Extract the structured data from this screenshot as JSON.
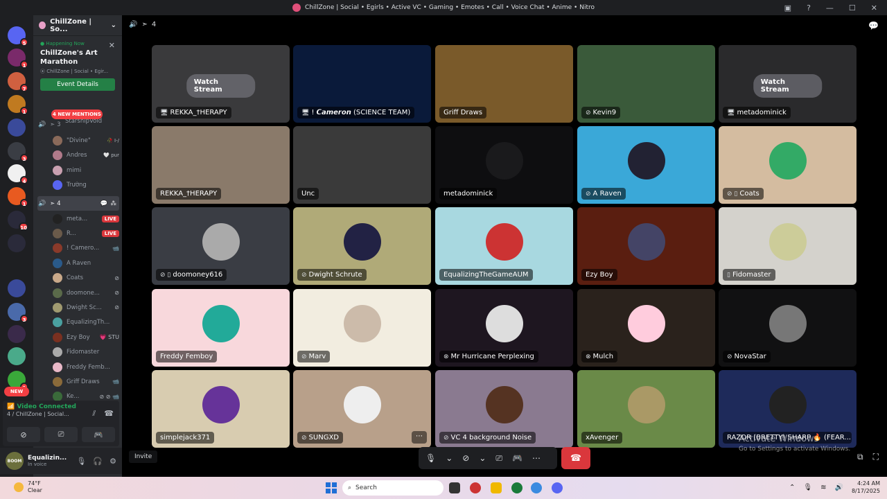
{
  "titlebar": {
    "title": "ChillZone | Social • Egirls • Active VC • Gaming • Emotes • Call • Voice Chat • Anime • Nitro"
  },
  "server_rail": {
    "badges": [
      "5",
      "1",
      "7",
      "1",
      "3",
      "4",
      "1",
      "10",
      "3",
      "1"
    ],
    "new_label": "NEW"
  },
  "sidebar": {
    "server_name": "ChillZone | So...",
    "event": {
      "status": "Happening Now",
      "title": "ChillZone's Art Marathon",
      "location": "ChillZone | Social • Egir...",
      "button": "Event Details"
    },
    "mentions": "4 NEW MENTIONS",
    "partial_user": "StarshipVoid",
    "channel3": {
      "label": "3",
      "users": [
        {
          "name": "\"Divine\"",
          "tag": "🥀 I-/",
          "color": "#8a6a5a"
        },
        {
          "name": "Andres",
          "tag": "🤍 pur",
          "color": "#b07a8a"
        },
        {
          "name": "mimi",
          "tag": "",
          "color": "#c9a0b0"
        },
        {
          "name": "Trường",
          "tag": "",
          "color": "#5865f2"
        }
      ]
    },
    "channel4": {
      "label": "4",
      "users": [
        {
          "name": "meta...",
          "live": "LIVE",
          "icon": "",
          "color": "#222"
        },
        {
          "name": "R...",
          "live": "LIVE",
          "icon": "",
          "color": "#6a5a4a"
        },
        {
          "name": "! Camero...",
          "live": "",
          "icon": "📹",
          "color": "#8a3a2a"
        },
        {
          "name": "A Raven",
          "live": "",
          "icon": "",
          "color": "#2a5a8a"
        },
        {
          "name": "Coats",
          "live": "",
          "icon": "⊘",
          "color": "#c9a98a"
        },
        {
          "name": "doomone...",
          "live": "",
          "icon": "⊘",
          "color": "#5a6a4a"
        },
        {
          "name": "Dwight Sc...",
          "live": "",
          "icon": "⊘",
          "color": "#a09a70"
        },
        {
          "name": "EqualizingTh...",
          "live": "",
          "icon": "",
          "color": "#4aa0a0"
        },
        {
          "name": "Ezy Boy",
          "live": "",
          "icon": "💗 STU",
          "color": "#7a3020"
        },
        {
          "name": "Fidomaster",
          "live": "",
          "icon": "",
          "color": "#aaa"
        },
        {
          "name": "Freddy Femb...",
          "live": "",
          "icon": "",
          "color": "#e8b8c8"
        },
        {
          "name": "Griff Draws",
          "live": "",
          "icon": "📹",
          "color": "#8a6a3a"
        },
        {
          "name": "Ke...",
          "live": "",
          "icon": "⊘ ⊘ 📹",
          "color": "#3a6a3a"
        }
      ]
    }
  },
  "voice_panel": {
    "status": "Video Connected",
    "channel": "4 / ChillZone | Social..."
  },
  "user_panel": {
    "name": "Equalizin...",
    "status": "In voice",
    "avatar_text": "BOOM"
  },
  "main": {
    "channel_label": "4",
    "tiles": [
      {
        "label": "REKKA_†HERAPY",
        "prefix": "🖥",
        "watch": "Watch Stream",
        "bg": "#3a3a3c"
      },
      {
        "label": "! 𝘾𝙖𝙢𝙚𝙧𝙤𝙣 (SCIENCE TEAM)",
        "prefix": "🖥",
        "watch": "",
        "bg": "#0a1a3a"
      },
      {
        "label": "Griff Draws",
        "prefix": "",
        "watch": "",
        "bg": "#7a5a2a"
      },
      {
        "label": "Kevin9",
        "prefix": "⊘",
        "watch": "",
        "bg": "#3a5a3a"
      },
      {
        "label": "metadominick",
        "prefix": "🖥",
        "watch": "Watch Stream",
        "bg": "#2a2a2c"
      },
      {
        "label": "REKKA_†HERAPY",
        "prefix": "",
        "watch": "",
        "bg": "#8a7a6a"
      },
      {
        "label": "Unc",
        "prefix": "",
        "watch": "",
        "bg": "#3a3a3a"
      },
      {
        "label": "metadominick",
        "prefix": "",
        "watch": "",
        "bg": "#0e0e10"
      },
      {
        "label": "A Raven",
        "prefix": "⊘",
        "watch": "",
        "bg": "#3aa8d8"
      },
      {
        "label": "Coats",
        "prefix": "⊘ ▯",
        "watch": "",
        "bg": "#d4bca0"
      },
      {
        "label": "doomoney616",
        "prefix": "⊘ ▯",
        "watch": "",
        "bg": "#3a3d44"
      },
      {
        "label": "Dwight Schrute",
        "prefix": "⊘",
        "watch": "",
        "bg": "#b0aa78"
      },
      {
        "label": "EqualizingTheGameAUM",
        "prefix": "",
        "watch": "",
        "bg": "#a8d8e0"
      },
      {
        "label": "Ezy Boy",
        "prefix": "",
        "watch": "",
        "bg": "#5a1e10"
      },
      {
        "label": "Fidomaster",
        "prefix": "▯",
        "watch": "",
        "bg": "#d4d2cc"
      },
      {
        "label": "Freddy Femboy",
        "prefix": "",
        "watch": "",
        "bg": "#f8d8dc"
      },
      {
        "label": "Marv",
        "prefix": "⊘",
        "watch": "",
        "bg": "#f2ede0"
      },
      {
        "label": "Mr Hurricane Perplexing",
        "prefix": "⊗",
        "watch": "",
        "bg": "#1e1620"
      },
      {
        "label": "Mulch",
        "prefix": "⊗",
        "watch": "",
        "bg": "#2a221c"
      },
      {
        "label": "NovaStar",
        "prefix": "⊘",
        "watch": "",
        "bg": "#111112"
      },
      {
        "label": "simplejack371",
        "prefix": "",
        "watch": "",
        "bg": "#d8ccb0"
      },
      {
        "label": "SUNGXD",
        "prefix": "⊘",
        "watch": "",
        "bg": "#b8a08a"
      },
      {
        "label": "VC 4 background Noise",
        "prefix": "⊘",
        "watch": "",
        "bg": "#8a7a90"
      },
      {
        "label": "xAvenger",
        "prefix": "",
        "watch": "",
        "bg": "#6a8a48"
      },
      {
        "label": "RAZOR (BRETTY) SHARP 🔥 (FEAR...",
        "prefix": "",
        "watch": "",
        "bg": "#1e2a5a"
      }
    ],
    "invite": "Invite"
  },
  "watermark": {
    "line1": "Activate Windows",
    "line2": "Go to Settings to activate Windows."
  },
  "taskbar": {
    "temp": "74°F",
    "weather": "Clear",
    "search": "Search",
    "time": "4:24 AM",
    "date": "8/17/2025"
  }
}
